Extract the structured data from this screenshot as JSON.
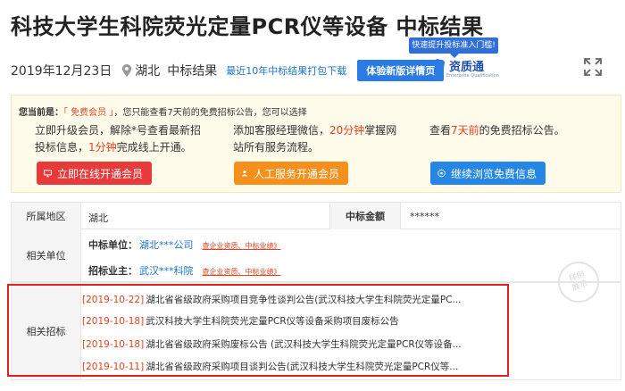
{
  "header": {
    "title": "科技大学生科院荧光定量PCR仪等设备 中标结果",
    "date": "2019年12月23日",
    "region": "湖北",
    "type": "中标结果",
    "download_link": "最近10年中标结果打包下载",
    "experience_button": "体验新版详情页"
  },
  "zzt": {
    "tip": "快速提升投标准入门槛!",
    "name": "资质通",
    "sub": "Enterprise Qualification"
  },
  "notice": {
    "prefix": "您当前是：",
    "member": "「 免费会员 」",
    "text": "，您只能查看7天前的免费招标公告，您可以选择",
    "col1_a": "立即升级会员，解除*号查看最新招",
    "col1_b": "投标信息，",
    "col1_red": "1分钟",
    "col1_c": "完成线上开通。",
    "col2_a": "添加客服经理微信，",
    "col2_red": "20分钟",
    "col2_b": "掌握网",
    "col2_c": "站所有服务流程。",
    "col3_a": "查看",
    "col3_red": "7天前",
    "col3_b": "的免费招标公告。",
    "btn_online": "立即在线开通会员",
    "btn_service": "人工服务开通会员",
    "btn_browse": "继续浏览免费信息"
  },
  "info": {
    "region_label": "所属地区",
    "region_value": "湖北",
    "amount_label": "中标金额",
    "amount_value": "******",
    "units_label": "相关单位",
    "winner_label": "中标单位：",
    "winner_value": "湖北***公司",
    "winner_link": "查企业资质、中标业绩》",
    "buyer_label": "招标业主：",
    "buyer_value": "武汉***科院",
    "buyer_link": "查企业资质、中标业绩》",
    "stamp_a": "样例",
    "stamp_b": "展示"
  },
  "related": {
    "label": "相关招标",
    "items": [
      {
        "date": "[2019-10-22]",
        "title": "湖北省省级政府采购项目竞争性谈判公告(武汉科技大学生科院荧光定量PC..."
      },
      {
        "date": "[2019-10-18]",
        "title": "武汉科技大学生科院荧光定量PCR仪等设备采购项目废标公告"
      },
      {
        "date": "[2019-10-18]",
        "title": "湖北省省级政府采购废标公告  (武汉科技大学生科院荧光定量PCR仪等设备..."
      },
      {
        "date": "[2019-10-11]",
        "title": "湖北省省级政府采购项目谈判公告(武汉科技大学生科院荧光定量PCR仪等..."
      }
    ]
  },
  "colors": {
    "accent_red": "#e4411f",
    "link_blue": "#1a73c8",
    "highlight_border": "#e3201b"
  }
}
